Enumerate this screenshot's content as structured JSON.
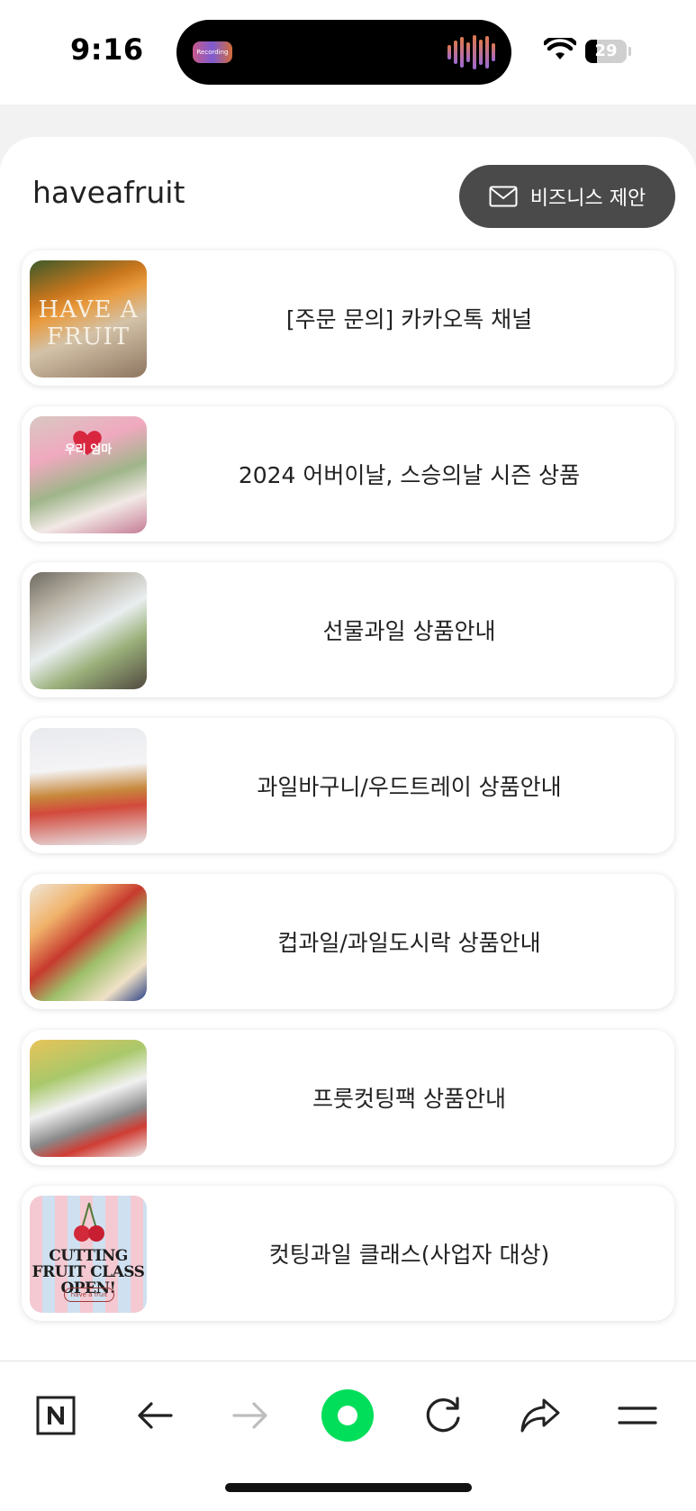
{
  "status_bar": {
    "time": "9:16",
    "island_label": "Recording",
    "battery_level": "29",
    "battery_fraction": 0.29
  },
  "profile": {
    "name": "haveafruit",
    "business_button_label": "비즈니스 제안",
    "business_icon": "mail-icon"
  },
  "links": [
    {
      "label": "[주문 문의] 카카오톡 채널",
      "thumb_text": "HAVE A FRUIT"
    },
    {
      "label": "2024 어버이날, 스승의날 시즌 상품",
      "thumb_text": "우리 엄마"
    },
    {
      "label": "선물과일 상품안내"
    },
    {
      "label": "과일바구니/우드트레이 상품안내"
    },
    {
      "label": "컵과일/과일도시락 상품안내"
    },
    {
      "label": "프룻컷팅팩 상품안내"
    },
    {
      "label": "컷팅과일 클래스(사업자 대상)",
      "thumb_text": "CUTTING FRUIT CLASS OPEN!",
      "thumb_subtext": "have a fruit"
    }
  ],
  "nav": {
    "items": [
      "naver-n-icon",
      "back-arrow-icon",
      "forward-arrow-icon",
      "green-dot-icon",
      "refresh-icon",
      "share-icon",
      "menu-icon"
    ],
    "accent_color": "#00de5a",
    "forward_disabled_color": "#bdbdbd"
  }
}
